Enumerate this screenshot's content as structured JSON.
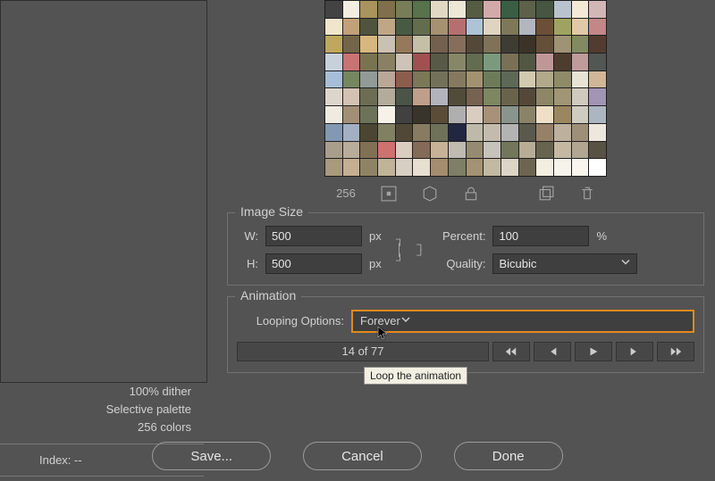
{
  "left": {
    "dither": "100% dither",
    "palette": "Selective palette",
    "colors": "256 colors",
    "index_label": "Index:",
    "index_value": "--"
  },
  "color_table": {
    "count": "256",
    "swatches": [
      "#434343",
      "#f2eee2",
      "#a9935e",
      "#7f6f4a",
      "#777d59",
      "#58724b",
      "#e1d9c4",
      "#ede7d7",
      "#565c44",
      "#d3aaaa",
      "#3a5e43",
      "#5e6149",
      "#465640",
      "#b9c3cf",
      "#f3e9d7",
      "#d3b6b6",
      "#f1e5cc",
      "#c1a178",
      "#50533d",
      "#bfa686",
      "#485a43",
      "#636d4e",
      "#a69171",
      "#b66f6f",
      "#afc3d6",
      "#dfd4c0",
      "#7f7858",
      "#b2b6bf",
      "#6c4f37",
      "#9fa362",
      "#e1c8a8",
      "#c28787",
      "#bfa75e",
      "#726548",
      "#d6b77e",
      "#c9c1b3",
      "#96795b",
      "#c4bfa6",
      "#73604f",
      "#866e5b",
      "#544939",
      "#7f7259",
      "#3d3d34",
      "#3b3327",
      "#644f38",
      "#9f9375",
      "#828a61",
      "#523c2f",
      "#c7d1dc",
      "#c97373",
      "#7a7350",
      "#8a8165",
      "#cfc2b6",
      "#a05050",
      "#585946",
      "#878768",
      "#636b51",
      "#7a9a7e",
      "#797055",
      "#515743",
      "#c09797",
      "#4e3c2f",
      "#bf9b9b",
      "#535754",
      "#a7bed8",
      "#76865e",
      "#929b97",
      "#bba797",
      "#8b5e4b",
      "#7a7856",
      "#74715b",
      "#857a5f",
      "#a29270",
      "#6c7c5a",
      "#5e6857",
      "#d2cab0",
      "#b1a98a",
      "#8f8a68",
      "#e7e3d5",
      "#cfb797",
      "#ddd6cd",
      "#d3c2b4",
      "#6d6d55",
      "#b4ac9a",
      "#4a5447",
      "#bf9f89",
      "#b3b3bd",
      "#514c39",
      "#756250",
      "#7d8762",
      "#6a634c",
      "#544839",
      "#8e8667",
      "#a09574",
      "#d0c9bd",
      "#a295b3",
      "#f0ebe1",
      "#a18f76",
      "#6d7359",
      "#f7f2e7",
      "#42413f",
      "#38342b",
      "#5a4c36",
      "#b0afb0",
      "#d9cdc0",
      "#a89179",
      "#89948c",
      "#8a8368",
      "#eedfc6",
      "#9b875f",
      "#ceccc0",
      "#acb6c1",
      "#8298b3",
      "#a3afc2",
      "#4b4632",
      "#828062",
      "#514936",
      "#877c61",
      "#6f7159",
      "#212641",
      "#bfb9a9",
      "#c3bcae",
      "#b3b3b3",
      "#595a4c",
      "#968168",
      "#bdb09d",
      "#9e9078",
      "#ede7de",
      "#a99e8b",
      "#b7ad9a",
      "#827054",
      "#cd7171",
      "#d9cdc0",
      "#836b57",
      "#c7b298",
      "#bfbbb0",
      "#958a72",
      "#c6c3bb",
      "#72765b",
      "#b7ac95",
      "#68634f",
      "#c4b8a3",
      "#b1a691",
      "#575243",
      "#a89a7d",
      "#c4af92",
      "#8e8465",
      "#bfb399",
      "#d7cfc1",
      "#e7dfd1",
      "#a48c6f",
      "#7f7e66",
      "#a39273",
      "#c2b9a2",
      "#dcd4c7",
      "#6d654f",
      "#f4eee0",
      "#f6f3eb",
      "#f8f5ee",
      "#ffffff"
    ]
  },
  "image_size": {
    "legend": "Image Size",
    "w_label": "W:",
    "h_label": "H:",
    "w": "500",
    "h": "500",
    "unit": "px",
    "percent_label": "Percent:",
    "percent": "100",
    "pct_unit": "%",
    "quality_label": "Quality:",
    "quality": "Bicubic"
  },
  "animation": {
    "legend": "Animation",
    "looping_label": "Looping Options:",
    "looping_value": "Forever",
    "frame_text": "14 of 77",
    "tooltip": "Loop the animation"
  },
  "buttons": {
    "save": "Save...",
    "cancel": "Cancel",
    "done": "Done"
  }
}
